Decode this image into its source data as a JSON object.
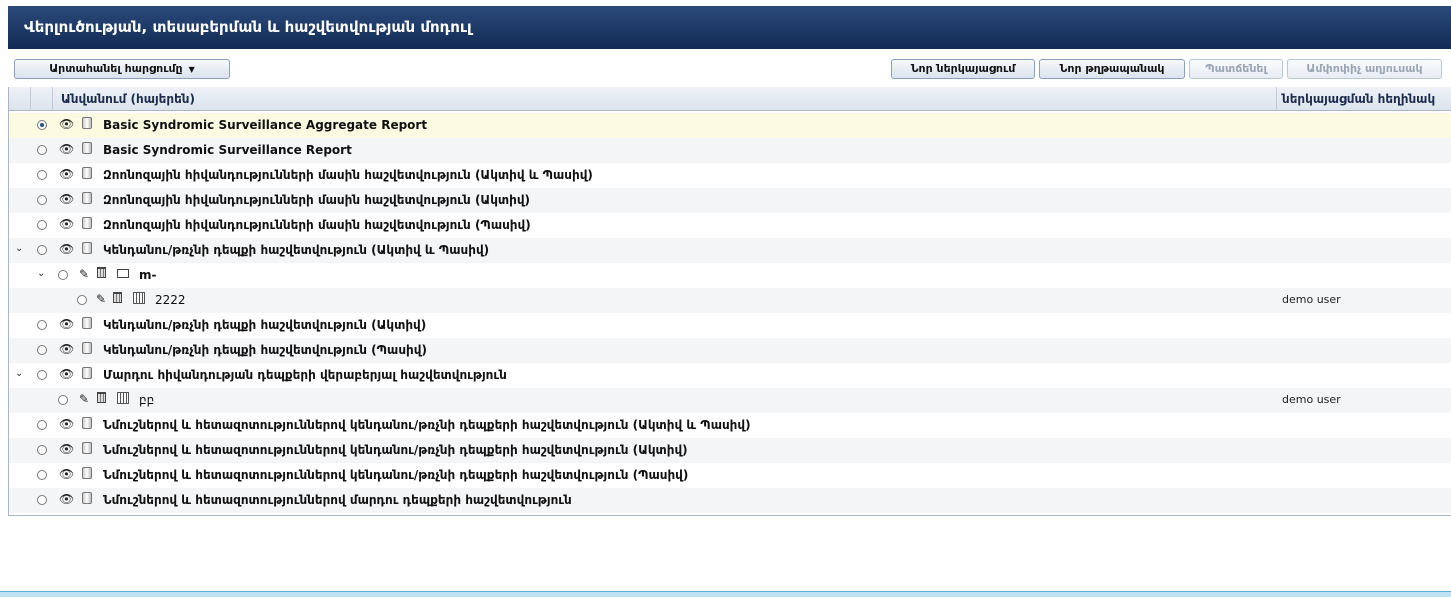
{
  "header": {
    "title": "Վերլուծության, տեսաբերման և հաշվետվության մոդուլ"
  },
  "toolbar": {
    "advanced_search": "Արտահանել հարցումը",
    "new_presentation": "Նոր ներկայացում",
    "new_folder": "Նոր թղթապանակ",
    "duplicate": "Պատճենել",
    "change_access": "Ամփոփիչ աղյուսակ"
  },
  "grid": {
    "columns": [
      "Անվանում (հայերեն)",
      "ներկայացման հեղինակ"
    ],
    "rows": [
      {
        "name": "Basic Syndromic Surveillance Aggregate Report",
        "owner": "",
        "selected": true
      },
      {
        "name": "Basic Syndromic Surveillance Report",
        "owner": ""
      },
      {
        "name": "Զոոնոզային հիվանդությունների մասին հաշվետվություն (Ակտիվ և Պասիվ)",
        "owner": ""
      },
      {
        "name": "Զոոնոզային հիվանդությունների մասին հաշվետվություն (Ակտիվ)",
        "owner": ""
      },
      {
        "name": "Զոոնոզային հիվանդությունների մասին հաշվետվություն (Պասիվ)",
        "owner": ""
      },
      {
        "name": "Կենդանու/թռչնի դեպքի հաշվետվություն (Ակտիվ և Պասիվ)",
        "owner": ""
      },
      {
        "name": "m-",
        "owner": ""
      },
      {
        "name": "2222",
        "owner": "demo user"
      },
      {
        "name": "Կենդանու/թռչնի դեպքի հաշվետվություն (Ակտիվ)",
        "owner": ""
      },
      {
        "name": "Կենդանու/թռչնի դեպքի հաշվետվություն (Պասիվ)",
        "owner": ""
      },
      {
        "name": "Մարդու հիվանդության դեպքերի վերաբերյալ հաշվետվություն",
        "owner": ""
      },
      {
        "name": "բբ",
        "owner": "demo user"
      },
      {
        "name": "Նմուշներով և հետազոտություններով կենդանու/թռչնի դեպքերի հաշվետվություն (Ակտիվ և Պասիվ)",
        "owner": ""
      },
      {
        "name": "Նմուշներով և հետազոտություններով կենդանու/թռչնի դեպքերի հաշվետվություն (Ակտիվ)",
        "owner": ""
      },
      {
        "name": "Նմուշներով և հետազոտություններով կենդանու/թռչնի դեպքերի հաշվետվություն (Պասիվ)",
        "owner": ""
      },
      {
        "name": "Նմուշներով և հետազոտություններով մարդու դեպքերի հաշվետվություն",
        "owner": ""
      }
    ]
  }
}
